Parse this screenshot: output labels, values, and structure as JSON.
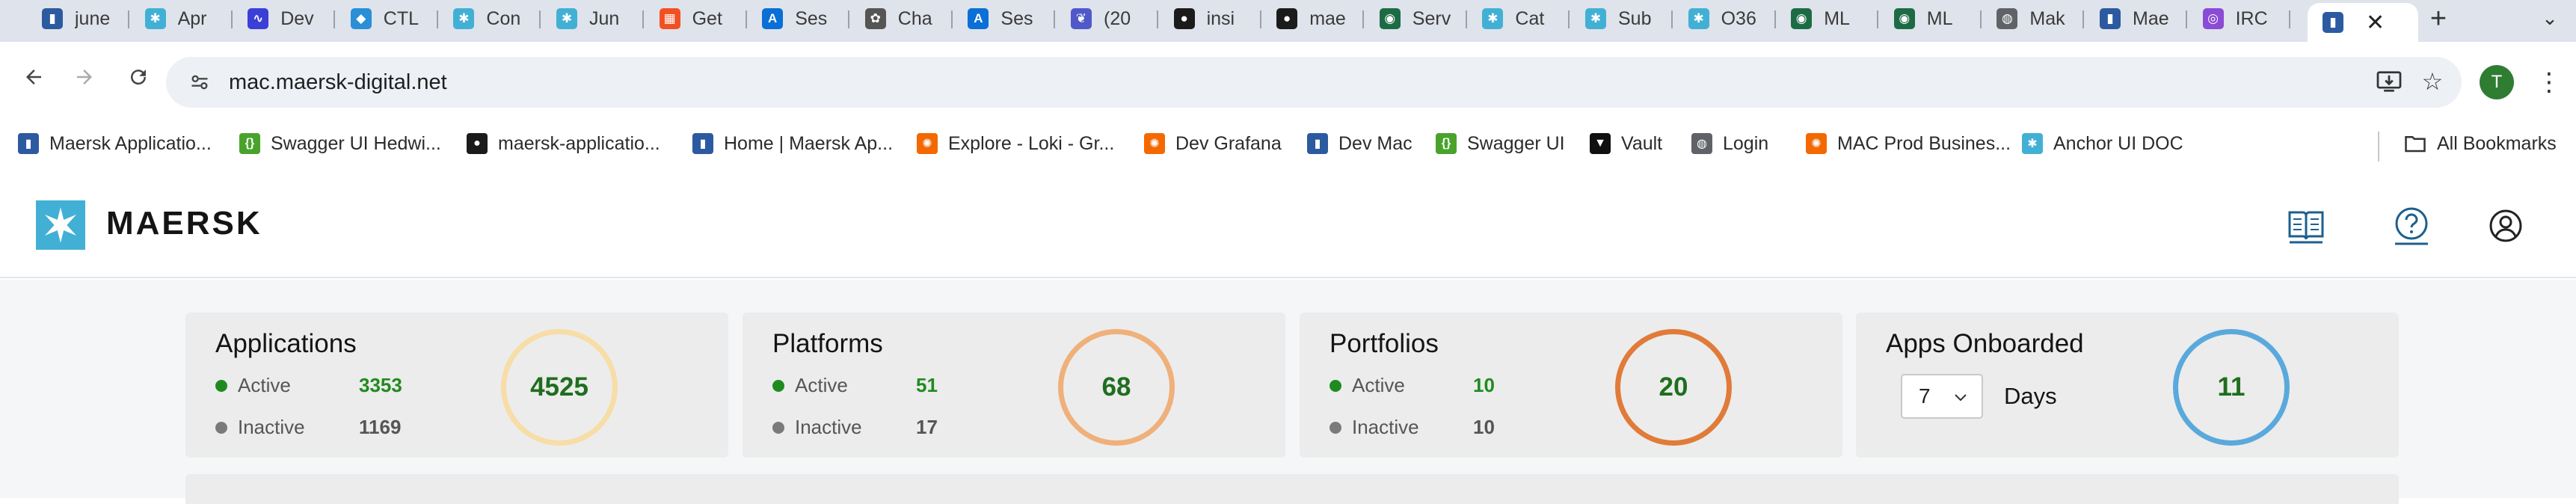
{
  "browser": {
    "tabs": [
      {
        "title": "june",
        "icon": "maersk-docs-icon",
        "color": "#2c5aa0",
        "glyph": "▮"
      },
      {
        "title": "Apr",
        "icon": "maersk-star-icon",
        "color": "#42b0d5",
        "glyph": "✱"
      },
      {
        "title": "Dev",
        "icon": "grafana-faro-icon",
        "color": "#3b3fd8",
        "glyph": "∿"
      },
      {
        "title": "CTL",
        "icon": "diamond-icon",
        "color": "#2a8fd6",
        "glyph": "◆"
      },
      {
        "title": "Con",
        "icon": "maersk-star-icon",
        "color": "#42b0d5",
        "glyph": "✱"
      },
      {
        "title": "Jun",
        "icon": "maersk-star-icon",
        "color": "#42b0d5",
        "glyph": "✱"
      },
      {
        "title": "Get",
        "icon": "microsoft-icon",
        "color": "#f25022",
        "glyph": "▦"
      },
      {
        "title": "Ses",
        "icon": "azure-icon",
        "color": "#0a6fd6",
        "glyph": "A"
      },
      {
        "title": "Cha",
        "icon": "openai-icon",
        "color": "#555555",
        "glyph": "✿"
      },
      {
        "title": "Ses",
        "icon": "azure-icon",
        "color": "#0a6fd6",
        "glyph": "A"
      },
      {
        "title": "(20",
        "icon": "teams-icon",
        "color": "#5059c9",
        "glyph": "❦"
      },
      {
        "title": "insi",
        "icon": "github-icon",
        "color": "#1b1b1b",
        "glyph": "●"
      },
      {
        "title": "mae",
        "icon": "github-icon",
        "color": "#1b1b1b",
        "glyph": "●"
      },
      {
        "title": "Serv",
        "icon": "servicenow-icon",
        "color": "#1d6b45",
        "glyph": "◉"
      },
      {
        "title": "Cat",
        "icon": "maersk-star-icon",
        "color": "#42b0d5",
        "glyph": "✱"
      },
      {
        "title": "Sub",
        "icon": "maersk-star-icon",
        "color": "#42b0d5",
        "glyph": "✱"
      },
      {
        "title": "O36",
        "icon": "maersk-star-icon",
        "color": "#42b0d5",
        "glyph": "✱"
      },
      {
        "title": "ML",
        "icon": "servicenow-icon",
        "color": "#1d6b45",
        "glyph": "◉"
      },
      {
        "title": "ML",
        "icon": "servicenow-icon",
        "color": "#1d6b45",
        "glyph": "◉"
      },
      {
        "title": "Mak",
        "icon": "globe-icon",
        "color": "#5f6368",
        "glyph": "◍"
      },
      {
        "title": "Mae",
        "icon": "maersk-docs-icon",
        "color": "#2c5aa0",
        "glyph": "▮"
      },
      {
        "title": "IRC",
        "icon": "irctc-icon",
        "color": "#8a4bd6",
        "glyph": "◎"
      }
    ],
    "active_tab": {
      "icon": "maersk-docs-icon",
      "color": "#2c5aa0",
      "glyph": "▮",
      "close": "✕"
    },
    "new_tab": "+",
    "tab_search": "⌄",
    "url": "mac.maersk-digital.net",
    "profile_initial": "T",
    "bookmarks": [
      {
        "label": "Maersk Applicatio...",
        "icon": "maersk-docs-icon",
        "color": "#2c5aa0",
        "glyph": "▮"
      },
      {
        "label": "Swagger UI Hedwi...",
        "icon": "swagger-icon",
        "color": "#49a32b",
        "glyph": "{}"
      },
      {
        "label": "maersk-applicatio...",
        "icon": "github-icon",
        "color": "#1b1b1b",
        "glyph": "●"
      },
      {
        "label": "Home | Maersk Ap...",
        "icon": "maersk-docs-icon",
        "color": "#2c5aa0",
        "glyph": "▮"
      },
      {
        "label": "Explore - Loki - Gr...",
        "icon": "grafana-icon",
        "color": "#f46800",
        "glyph": "✺"
      },
      {
        "label": "Dev Grafana",
        "icon": "grafana-icon",
        "color": "#f46800",
        "glyph": "✺"
      },
      {
        "label": "Dev Mac",
        "icon": "maersk-docs-icon",
        "color": "#2c5aa0",
        "glyph": "▮"
      },
      {
        "label": "Swagger UI",
        "icon": "swagger-icon",
        "color": "#49a32b",
        "glyph": "{}"
      },
      {
        "label": "Vault",
        "icon": "vault-icon",
        "color": "#111111",
        "glyph": "▼"
      },
      {
        "label": "Login",
        "icon": "globe-icon",
        "color": "#5f6368",
        "glyph": "◍"
      },
      {
        "label": "MAC Prod Busines...",
        "icon": "grafana-icon",
        "color": "#f46800",
        "glyph": "✺"
      },
      {
        "label": "Anchor UI DOC",
        "icon": "maersk-star-icon",
        "color": "#42b0d5",
        "glyph": "✱"
      }
    ],
    "all_bookmarks": "All Bookmarks"
  },
  "app": {
    "brand": "MAERSK",
    "cards": [
      {
        "title": "Applications",
        "active_label": "Active",
        "active_value": "3353",
        "inactive_label": "Inactive",
        "inactive_value": "1169",
        "total": "4525",
        "ring_color": "#f7dda6"
      },
      {
        "title": "Platforms",
        "active_label": "Active",
        "active_value": "51",
        "inactive_label": "Inactive",
        "inactive_value": "17",
        "total": "68",
        "ring_color": "#efb07a"
      },
      {
        "title": "Portfolios",
        "active_label": "Active",
        "active_value": "10",
        "inactive_label": "Inactive",
        "inactive_value": "10",
        "total": "20",
        "ring_color": "#e07b39"
      }
    ],
    "onboarded": {
      "title": "Apps Onboarded",
      "select_value": "7",
      "unit": "Days",
      "total": "11",
      "ring_color": "#5aa9dc"
    }
  }
}
